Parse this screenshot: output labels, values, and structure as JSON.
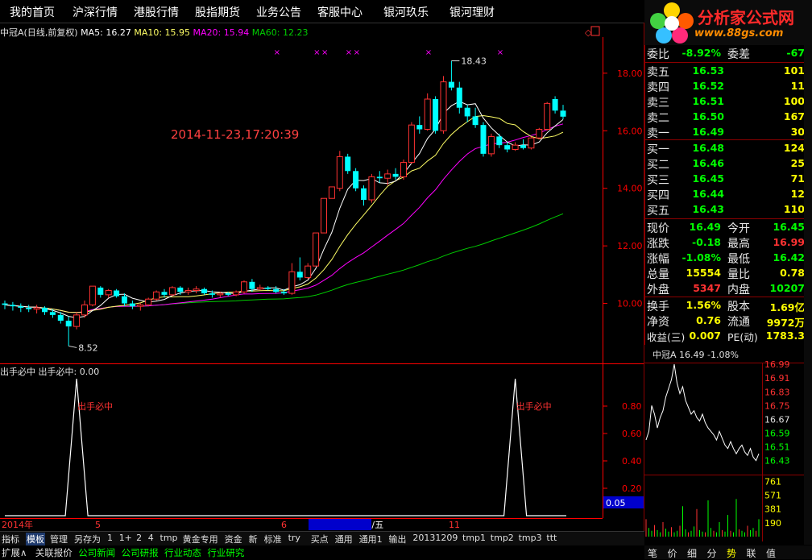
{
  "menu": [
    "我的首页",
    "沪深行情",
    "港股行情",
    "股指期货",
    "业务公告",
    "客服中心",
    "银河玖乐",
    "银河理财"
  ],
  "logo": {
    "site": "分析家公式网",
    "url": "www.88gs.com"
  },
  "header": {
    "name": "中冠A(日线,前复权)",
    "ma5": "MA5: 16.27",
    "ma10": "MA10: 15.95",
    "ma20": "MA20: 15.94",
    "ma60": "MA60: 12.23"
  },
  "colors": {
    "up": "#ff3232",
    "down": "#00ffff",
    "ma5": "#ffffff",
    "ma10": "#ffff66",
    "ma20": "#ff00ff",
    "ma60": "#00cc00",
    "axis": "#ff0000",
    "accent": "#ff2a2a"
  },
  "overlay_timestamp": "2014-11-23,17:20:39",
  "chart_data": [
    {
      "type": "candlestick",
      "title": "中冠A(日线,前复权)",
      "ylim": [
        8.0,
        19.2
      ],
      "yticks": [
        "10.00",
        "12.00",
        "14.00",
        "16.00",
        "18.00"
      ],
      "xticks": [
        "2014年",
        "5",
        "6",
        "2014/06/06/五",
        "11"
      ],
      "annotations": [
        {
          "label": "18.43",
          "value": 18.43
        },
        {
          "label": "8.52",
          "value": 8.52
        }
      ],
      "markers": [
        "×",
        "×",
        "×",
        "×",
        "×",
        "×",
        "×"
      ],
      "candles": [
        {
          "o": 10.0,
          "h": 10.1,
          "l": 9.8,
          "c": 9.95
        },
        {
          "o": 9.95,
          "h": 10.05,
          "l": 9.75,
          "c": 9.9
        },
        {
          "o": 9.9,
          "h": 10.0,
          "l": 9.7,
          "c": 9.85
        },
        {
          "o": 9.85,
          "h": 9.95,
          "l": 9.7,
          "c": 9.8
        },
        {
          "o": 9.8,
          "h": 9.95,
          "l": 9.65,
          "c": 9.85
        },
        {
          "o": 9.85,
          "h": 9.9,
          "l": 9.6,
          "c": 9.7
        },
        {
          "o": 9.7,
          "h": 9.8,
          "l": 9.5,
          "c": 9.6
        },
        {
          "o": 9.6,
          "h": 9.7,
          "l": 9.3,
          "c": 9.4
        },
        {
          "o": 9.4,
          "h": 9.55,
          "l": 8.52,
          "c": 9.2
        },
        {
          "o": 9.2,
          "h": 9.7,
          "l": 9.1,
          "c": 9.6
        },
        {
          "o": 9.6,
          "h": 10.1,
          "l": 9.5,
          "c": 9.95
        },
        {
          "o": 9.95,
          "h": 10.6,
          "l": 9.9,
          "c": 10.6
        },
        {
          "o": 10.55,
          "h": 10.6,
          "l": 10.2,
          "c": 10.3
        },
        {
          "o": 10.3,
          "h": 10.5,
          "l": 10.2,
          "c": 10.45
        },
        {
          "o": 10.45,
          "h": 10.5,
          "l": 10.2,
          "c": 10.25
        },
        {
          "o": 10.25,
          "h": 10.35,
          "l": 9.9,
          "c": 10.0
        },
        {
          "o": 10.0,
          "h": 10.1,
          "l": 9.8,
          "c": 9.9
        },
        {
          "o": 9.9,
          "h": 10.0,
          "l": 9.75,
          "c": 9.95
        },
        {
          "o": 9.95,
          "h": 10.2,
          "l": 9.9,
          "c": 10.15
        },
        {
          "o": 10.15,
          "h": 10.45,
          "l": 10.1,
          "c": 10.4
        },
        {
          "o": 10.4,
          "h": 10.5,
          "l": 10.2,
          "c": 10.3
        },
        {
          "o": 10.3,
          "h": 10.6,
          "l": 10.25,
          "c": 10.55
        },
        {
          "o": 10.55,
          "h": 10.6,
          "l": 10.3,
          "c": 10.4
        },
        {
          "o": 10.4,
          "h": 10.55,
          "l": 10.3,
          "c": 10.45
        },
        {
          "o": 10.45,
          "h": 10.6,
          "l": 10.35,
          "c": 10.5
        },
        {
          "o": 10.5,
          "h": 10.55,
          "l": 10.3,
          "c": 10.35
        },
        {
          "o": 10.35,
          "h": 10.45,
          "l": 10.2,
          "c": 10.3
        },
        {
          "o": 10.3,
          "h": 10.4,
          "l": 10.2,
          "c": 10.35
        },
        {
          "o": 10.35,
          "h": 10.4,
          "l": 10.25,
          "c": 10.3
        },
        {
          "o": 10.3,
          "h": 10.45,
          "l": 10.25,
          "c": 10.4
        },
        {
          "o": 10.4,
          "h": 10.8,
          "l": 10.35,
          "c": 10.75
        },
        {
          "o": 10.75,
          "h": 10.85,
          "l": 10.4,
          "c": 10.5
        },
        {
          "o": 10.5,
          "h": 10.65,
          "l": 10.45,
          "c": 10.55
        },
        {
          "o": 10.55,
          "h": 10.6,
          "l": 10.45,
          "c": 10.5
        },
        {
          "o": 10.5,
          "h": 10.6,
          "l": 10.35,
          "c": 10.4
        },
        {
          "o": 10.4,
          "h": 10.5,
          "l": 10.3,
          "c": 10.35
        },
        {
          "o": 10.35,
          "h": 11.4,
          "l": 10.3,
          "c": 11.1
        },
        {
          "o": 11.1,
          "h": 11.6,
          "l": 10.8,
          "c": 10.9
        },
        {
          "o": 10.9,
          "h": 11.4,
          "l": 10.85,
          "c": 11.3
        },
        {
          "o": 11.3,
          "h": 12.45,
          "l": 11.3,
          "c": 12.45
        },
        {
          "o": 12.45,
          "h": 13.65,
          "l": 12.45,
          "c": 13.65
        },
        {
          "o": 13.65,
          "h": 14.05,
          "l": 13.65,
          "c": 14.05
        },
        {
          "o": 14.0,
          "h": 15.3,
          "l": 13.9,
          "c": 15.1
        },
        {
          "o": 15.1,
          "h": 15.2,
          "l": 14.5,
          "c": 14.6
        },
        {
          "o": 14.6,
          "h": 14.7,
          "l": 13.9,
          "c": 14.0
        },
        {
          "o": 14.0,
          "h": 14.1,
          "l": 13.4,
          "c": 13.6
        },
        {
          "o": 13.6,
          "h": 14.5,
          "l": 13.5,
          "c": 14.4
        },
        {
          "o": 14.4,
          "h": 14.6,
          "l": 14.2,
          "c": 14.35
        },
        {
          "o": 14.35,
          "h": 14.65,
          "l": 14.1,
          "c": 14.5
        },
        {
          "o": 14.5,
          "h": 14.7,
          "l": 14.3,
          "c": 14.4
        },
        {
          "o": 14.4,
          "h": 15.0,
          "l": 14.3,
          "c": 14.9
        },
        {
          "o": 14.9,
          "h": 16.3,
          "l": 14.85,
          "c": 16.2
        },
        {
          "o": 16.2,
          "h": 16.5,
          "l": 15.9,
          "c": 16.05
        },
        {
          "o": 16.05,
          "h": 17.3,
          "l": 16.0,
          "c": 17.1
        },
        {
          "o": 17.1,
          "h": 17.2,
          "l": 15.9,
          "c": 16.0
        },
        {
          "o": 16.0,
          "h": 17.9,
          "l": 15.9,
          "c": 17.7
        },
        {
          "o": 17.7,
          "h": 18.43,
          "l": 17.4,
          "c": 17.5
        },
        {
          "o": 17.5,
          "h": 17.7,
          "l": 16.6,
          "c": 16.8
        },
        {
          "o": 16.8,
          "h": 16.9,
          "l": 16.3,
          "c": 16.5
        },
        {
          "o": 16.5,
          "h": 16.8,
          "l": 16.1,
          "c": 16.2
        },
        {
          "o": 16.2,
          "h": 16.3,
          "l": 15.1,
          "c": 15.2
        },
        {
          "o": 15.2,
          "h": 15.9,
          "l": 15.1,
          "c": 15.8
        },
        {
          "o": 15.8,
          "h": 15.9,
          "l": 15.4,
          "c": 15.5
        },
        {
          "o": 15.5,
          "h": 15.6,
          "l": 15.25,
          "c": 15.35
        },
        {
          "o": 15.35,
          "h": 15.6,
          "l": 15.3,
          "c": 15.5
        },
        {
          "o": 15.5,
          "h": 15.7,
          "l": 15.35,
          "c": 15.4
        },
        {
          "o": 15.4,
          "h": 15.8,
          "l": 15.35,
          "c": 15.75
        },
        {
          "o": 15.75,
          "h": 16.1,
          "l": 15.7,
          "c": 16.05
        },
        {
          "o": 16.05,
          "h": 17.0,
          "l": 16.0,
          "c": 16.95
        },
        {
          "o": 17.1,
          "h": 17.2,
          "l": 16.6,
          "c": 16.7
        },
        {
          "o": 16.7,
          "h": 16.9,
          "l": 16.4,
          "c": 16.49
        }
      ],
      "ma_period_labels": {
        "ma5": "MA5",
        "ma10": "MA10",
        "ma20": "MA20",
        "ma60": "MA60"
      }
    },
    {
      "type": "line",
      "title": "出手必中 出手必中: 0.00",
      "ylim": [
        0,
        1.0
      ],
      "yticks": [
        "0.20",
        "0.40",
        "0.60",
        "0.80"
      ],
      "current_value": "0.05",
      "signal_label": "出手必中",
      "signals_at_candle": [
        9,
        64
      ]
    },
    {
      "type": "line",
      "title": "中冠A 16.49 -1.08%",
      "ylim": [
        16.4,
        17.0
      ],
      "yticks": [
        "16.99",
        "16.91",
        "16.83",
        "16.75",
        "16.67",
        "16.59",
        "16.51",
        "16.43"
      ],
      "values": [
        16.55,
        16.6,
        16.75,
        16.7,
        16.62,
        16.68,
        16.72,
        16.8,
        16.85,
        16.9,
        16.99,
        16.88,
        16.82,
        16.86,
        16.78,
        16.74,
        16.7,
        16.72,
        16.68,
        16.66,
        16.7,
        16.65,
        16.62,
        16.6,
        16.58,
        16.55,
        16.6,
        16.56,
        16.52,
        16.5,
        16.54,
        16.5,
        16.47,
        16.5,
        16.52,
        16.48,
        16.46,
        16.5,
        16.45,
        16.43,
        16.47
      ],
      "volume_ticks": [
        "761",
        "571",
        "381",
        "190"
      ],
      "volume_values": [
        240,
        120,
        80,
        160,
        90,
        60,
        200,
        110,
        70,
        130,
        60,
        80,
        150,
        420,
        100,
        60,
        80,
        140,
        380,
        90,
        70,
        60,
        500,
        120,
        80,
        60,
        200,
        90,
        70,
        300,
        80,
        60,
        520,
        100,
        80,
        60,
        150,
        90,
        120,
        80,
        240
      ]
    }
  ],
  "quote": {
    "rows": [
      {
        "label": "委比",
        "value": "-8.92%",
        "label2": "委差",
        "value2": "-67",
        "color": "#00ff00",
        "color2": "#00ff00"
      },
      {
        "label": "卖五",
        "value": "16.53",
        "value2": "101",
        "color": "#00ff00",
        "color2": "#ffff00"
      },
      {
        "label": "卖四",
        "value": "16.52",
        "value2": "11",
        "color": "#00ff00",
        "color2": "#ffff00"
      },
      {
        "label": "卖三",
        "value": "16.51",
        "value2": "100",
        "color": "#00ff00",
        "color2": "#ffff00"
      },
      {
        "label": "卖二",
        "value": "16.50",
        "value2": "167",
        "color": "#00ff00",
        "color2": "#ffff00"
      },
      {
        "label": "卖一",
        "value": "16.49",
        "value2": "30",
        "color": "#00ff00",
        "color2": "#ffff00"
      },
      {
        "label": "买一",
        "value": "16.48",
        "value2": "124",
        "color": "#00ff00",
        "color2": "#ffff00"
      },
      {
        "label": "买二",
        "value": "16.46",
        "value2": "25",
        "color": "#00ff00",
        "color2": "#ffff00"
      },
      {
        "label": "买三",
        "value": "16.45",
        "value2": "71",
        "color": "#00ff00",
        "color2": "#ffff00"
      },
      {
        "label": "买四",
        "value": "16.44",
        "value2": "12",
        "color": "#00ff00",
        "color2": "#ffff00"
      },
      {
        "label": "买五",
        "value": "16.43",
        "value2": "110",
        "color": "#00ff00",
        "color2": "#ffff00"
      },
      {
        "label": "现价",
        "value": "16.49",
        "label2": "今开",
        "value2": "16.45",
        "color": "#00ff00",
        "color2": "#00ff00"
      },
      {
        "label": "涨跌",
        "value": "-0.18",
        "label2": "最高",
        "value2": "16.99",
        "color": "#00ff00",
        "color2": "#ff3232"
      },
      {
        "label": "涨幅",
        "value": "-1.08%",
        "label2": "最低",
        "value2": "16.42",
        "color": "#00ff00",
        "color2": "#00ff00"
      },
      {
        "label": "总量",
        "value": "15554",
        "label2": "量比",
        "value2": "0.78",
        "color": "#ffff00",
        "color2": "#ffff00"
      },
      {
        "label": "外盘",
        "value": "5347",
        "label2": "内盘",
        "value2": "10207",
        "color": "#ff3232",
        "color2": "#00ff00"
      },
      {
        "label": "换手",
        "value": "1.56%",
        "label2": "股本",
        "value2": "1.69亿",
        "color": "#ffff00",
        "color2": "#ffff00"
      },
      {
        "label": "净资",
        "value": "0.76",
        "label2": "流通",
        "value2": "9972万",
        "color": "#ffff00",
        "color2": "#ffff00"
      },
      {
        "label": "收益(三)",
        "value": "0.007",
        "label2": "PE(动)",
        "value2": "1783.3",
        "color": "#ffff00",
        "color2": "#ffff00"
      }
    ]
  },
  "mini_period": "日线",
  "tabs": [
    "指标",
    "模板",
    "管理",
    "另存为",
    "1",
    "1+",
    "2",
    "4",
    "tmp",
    "黄金专用",
    "资金",
    "新",
    "标准",
    "try",
    "买点",
    "通用",
    "通用1",
    "输出",
    "20131209",
    "tmp1",
    "tmp2",
    "tmp3",
    "ttt"
  ],
  "active_tab": "模板",
  "status_items": [
    {
      "text": "扩展∧",
      "color": "#e0e0e0"
    },
    {
      "text": "关联报价",
      "color": "#e0e0e0"
    },
    {
      "text": "公司新闻",
      "color": "#00ff00"
    },
    {
      "text": "公司研报",
      "color": "#00ff00"
    },
    {
      "text": "行业动态",
      "color": "#00ff00"
    },
    {
      "text": "行业研究",
      "color": "#00ff00"
    }
  ],
  "buttons": [
    "笔",
    "价",
    "细",
    "分",
    "势",
    "联",
    "值"
  ],
  "active_button": "势"
}
